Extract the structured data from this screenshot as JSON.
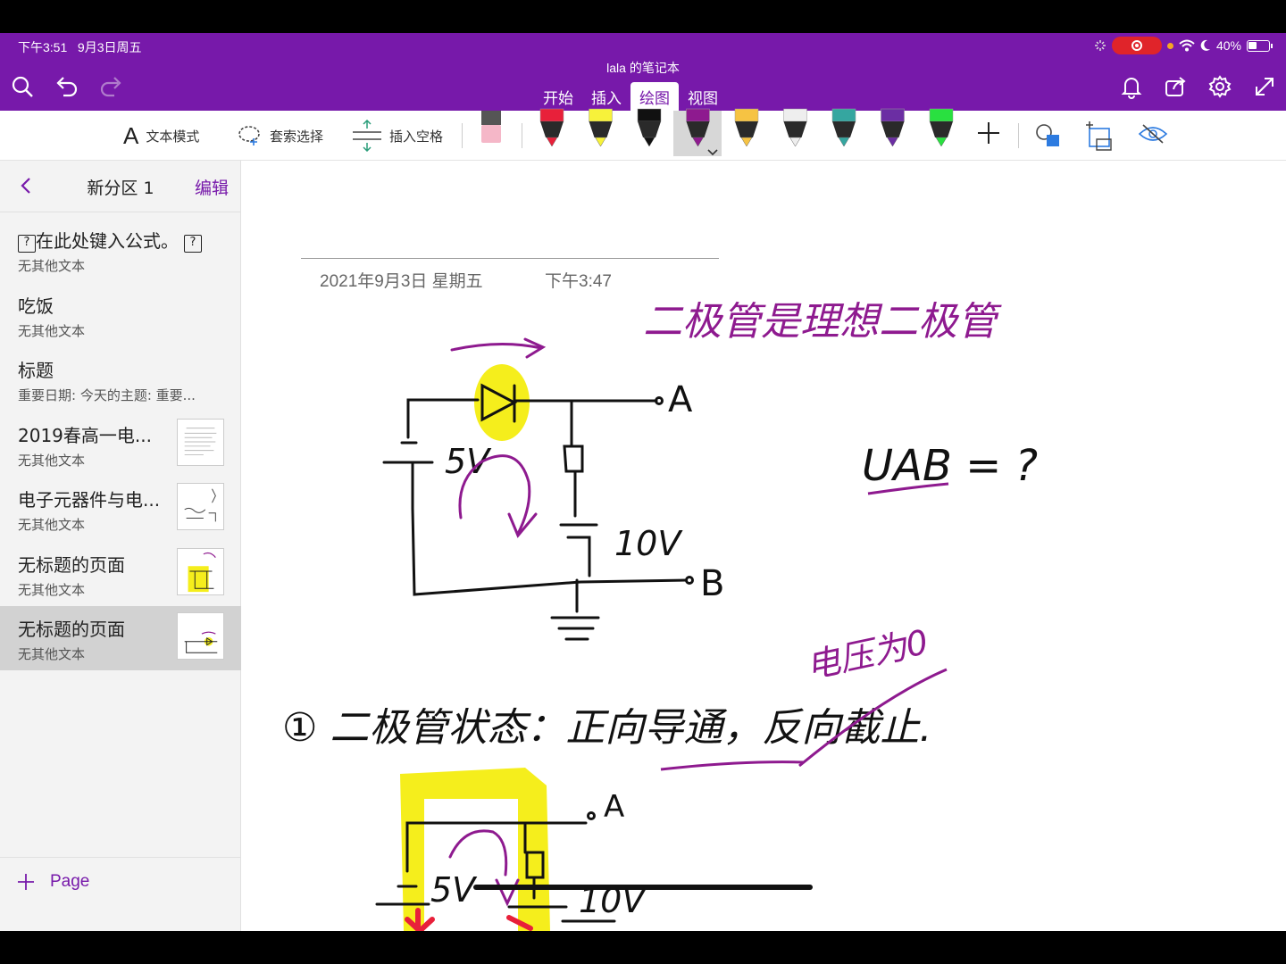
{
  "status_bar": {
    "time": "下午3:51",
    "date": "9月3日周五",
    "battery": "40%"
  },
  "topbar": {
    "notebook_title": "lala 的笔记本",
    "tabs": [
      {
        "label": "开始"
      },
      {
        "label": "插入"
      },
      {
        "label": "绘图",
        "active": true
      },
      {
        "label": "视图"
      }
    ]
  },
  "ribbon": {
    "text_mode": "文本模式",
    "lasso_select": "套索选择",
    "insert_space": "插入空格",
    "pen_colors": [
      "#e8203a",
      "#f7f23a",
      "#111111",
      "#8e1a8f",
      "#f6c343",
      "#eeeeee",
      "#35a6a0",
      "#6b2ea3",
      "#29e040"
    ]
  },
  "sidebar": {
    "section_name": "新分区 1",
    "edit_label": "编辑",
    "pages": [
      {
        "title": "在此处键入公式。",
        "subtitle": "无其他文本"
      },
      {
        "title": "吃饭",
        "subtitle": "无其他文本"
      },
      {
        "title": "标题",
        "subtitle": "重要日期: 今天的主题: 重要..."
      },
      {
        "title": "2019春高一电...",
        "subtitle": "无其他文本"
      },
      {
        "title": "电子元器件与电...",
        "subtitle": "无其他文本"
      },
      {
        "title": "无标题的页面",
        "subtitle": "无其他文本"
      },
      {
        "title": "无标题的页面",
        "subtitle": "无其他文本",
        "active": true
      }
    ],
    "add_page_label": "Page"
  },
  "page": {
    "date": "2021年9月3日 星期五",
    "time": "下午3:47"
  },
  "ink": {
    "note_purple": "二极管是理想二极管",
    "question": "UAB = ?",
    "label_a": "A",
    "label_b": "B",
    "label_5v": "5V",
    "label_10v": "10V",
    "step1": "① 二极管状态：正向导通，反向截止.",
    "note_zero": "电压为0",
    "purple": "#8e1a8f",
    "highlight": "#f5ee1c",
    "red": "#e8203a"
  }
}
